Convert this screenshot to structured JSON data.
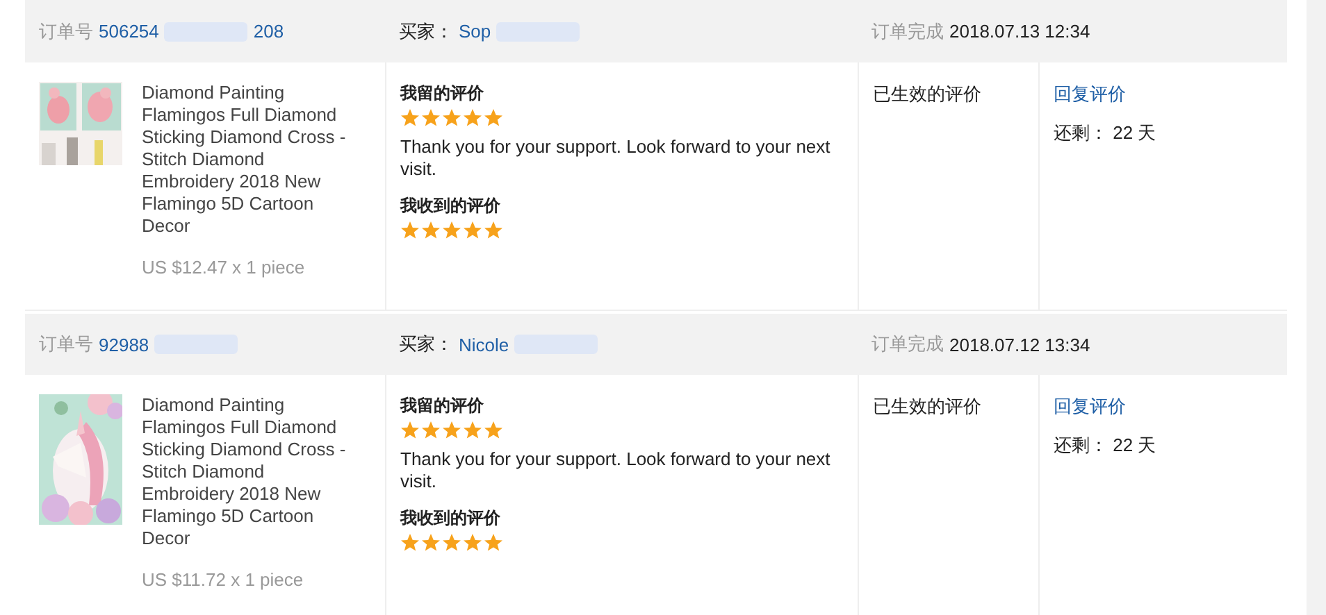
{
  "orders": [
    {
      "order_label": "订单号",
      "order_number_start": "506254",
      "order_number_end": "208",
      "buyer_label": "买家：",
      "buyer_name": "Sop",
      "completed_label": "订单完成",
      "completed_time": "2018.07.13 12:34",
      "product_title": "Diamond Painting Flamingos Full Diamond Sticking Diamond Cross - Stitch Diamond Embroidery 2018 New Flamingo 5D Cartoon Decor",
      "price": "US $12.47 x 1 piece",
      "my_review": {
        "label": "我留的评价",
        "stars": 5,
        "text": "Thank you for your support. Look forward to your next visit."
      },
      "received_review": {
        "label": "我收到的评价",
        "stars": 5
      },
      "status": "已生效的评价",
      "reply_link": "回复评价",
      "remaining": "还剩： 22 天"
    },
    {
      "order_label": "订单号",
      "order_number_start": "92988",
      "buyer_label": "买家：",
      "buyer_name": "Nicole",
      "completed_label": "订单完成",
      "completed_time": "2018.07.12 13:34",
      "product_title": "Diamond Painting Flamingos Full Diamond Sticking Diamond Cross - Stitch Diamond Embroidery 2018 New Flamingo 5D Cartoon Decor",
      "price": "US $11.72 x 1 piece",
      "my_review": {
        "label": "我留的评价",
        "stars": 5,
        "text": "Thank you for your support. Look forward to your next visit."
      },
      "received_review": {
        "label": "我收到的评价",
        "stars": 5
      },
      "status": "已生效的评价",
      "reply_link": "回复评价",
      "remaining": "还剩： 22 天"
    }
  ]
}
